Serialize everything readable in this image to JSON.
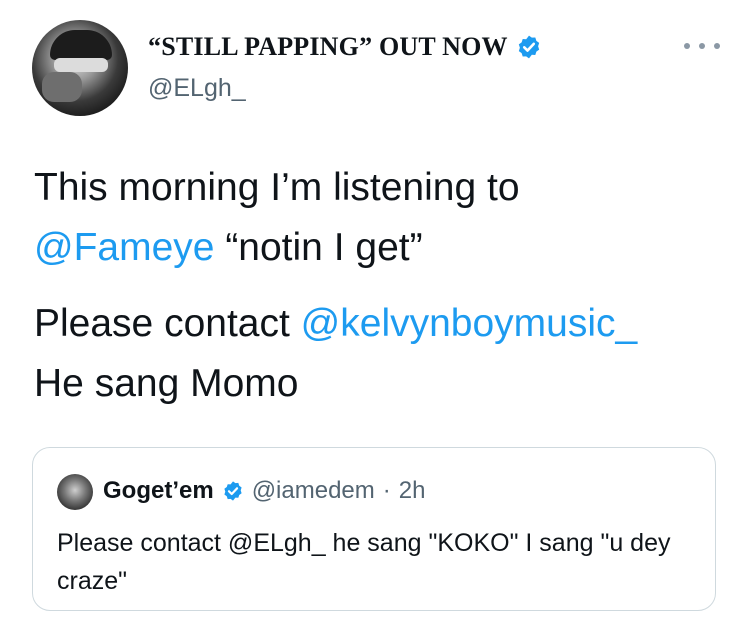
{
  "author": {
    "display_name": "“STILL PAPPING” OUT NOW",
    "handle": "@ELgh_",
    "verified_icon": "verified-badge-icon",
    "more_icon": "more-options-icon"
  },
  "tweet": {
    "line1": "This morning I’m listening to",
    "mention1": "@Fameye",
    "line2_rest": " “notin I get”",
    "line3_prefix": "Please contact ",
    "mention2": "@kelvynboymusic_",
    "line4": "He sang Momo"
  },
  "quoted": {
    "name": "Goget’em",
    "handle": "@iamedem",
    "separator": "·",
    "time": "2h",
    "text": "Please contact @ELgh_ he sang \"KOKO\" I sang \"u dey craze\""
  },
  "colors": {
    "mention": "#1d9bf0",
    "verified": "#1d9bf0",
    "secondary_text": "#536471",
    "border": "#cfd9de"
  }
}
